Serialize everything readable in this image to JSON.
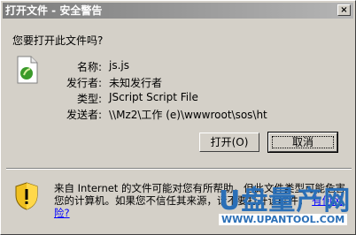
{
  "window": {
    "title": "打开文件 - 安全警告",
    "close_glyph": "×"
  },
  "question": "您要打开此文件吗?",
  "file_icon": "jscript-file-icon",
  "details": [
    {
      "label": "名称:",
      "value": "js.js"
    },
    {
      "label": "发行者:",
      "value": "未知发行者"
    },
    {
      "label": "类型:",
      "value": "JScript Script File"
    },
    {
      "label": "发送者:",
      "value": "\\\\Mz2\\工作 (e)\\wwwroot\\sos\\ht"
    }
  ],
  "buttons": {
    "open": "打开(O)",
    "cancel": "取消"
  },
  "warning": {
    "icon": "shield-warning-icon",
    "text": "来自 Internet 的文件可能对您有所帮助，但此文件类型可能危害您的计算机。如果您不信任其来源，请不要打开该软件。",
    "link": "有何风险?"
  },
  "watermark": {
    "title": "U盘量产网",
    "subtitle": "WWW.UPANTOOL.COM"
  }
}
